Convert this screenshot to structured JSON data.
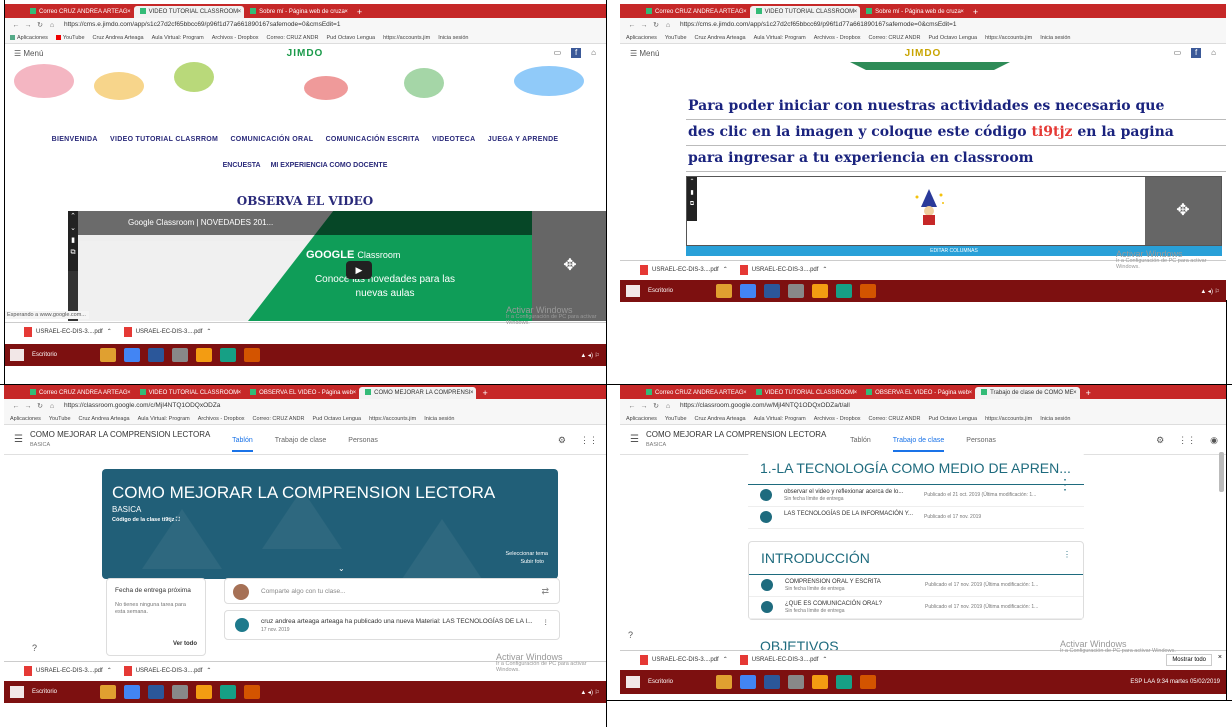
{
  "q1": {
    "tabs": [
      "Correo CRUZ ANDREA ARTEAG",
      "VIDEO TUTORIAL CLASSROOM",
      "Sobre mí - Página web de cruza"
    ],
    "url": "https://cms.e.jimdo.com/app/s1c27d2cf65bbcc69/p96f1d77a661890167safemode=0&cmsEdit=1",
    "bookmarks": [
      "Aplicaciones",
      "YouTube",
      "Cruz Andrea Arteaga",
      "Aula Virtual: Program",
      "Archivos - Dropbox",
      "Correo: CRUZ ANDR",
      "Pud Octavo Lengua",
      "https://accounts.jim",
      "Inicia sesión"
    ],
    "menu": "☰ Menú",
    "logo": "JIMDO",
    "nav1": [
      "BIENVENIDA",
      "VIDEO TUTORIAL CLASRROM",
      "COMUNICACIÓN ORAL",
      "COMUNICACIÓN ESCRITA",
      "VIDEOTECA",
      "JUEGA Y APRENDE"
    ],
    "nav2": [
      "ENCUESTA",
      "MI EXPERIENCIA COMO DOCENTE"
    ],
    "heading": "OBSERVA EL VIDEO",
    "video_title": "Google Classroom | NOVEDADES 201...",
    "video_brand": "GOOGLE",
    "video_brand2": "Classroom",
    "video_sub": "Conoce las novedades para las nuevas aulas",
    "status": "Esperando a www.google.com...",
    "downloads": [
      "USRAEL-EC-DIS-3....pdf",
      "USRAEL-EC-DIS-3....pdf"
    ],
    "download_sub": "Error: Error en el análisis antivi...",
    "wm1": "Activar Windows",
    "wm2": "Ir a Configuración de PC para activar Windows.",
    "taskbar_search": "Escritorio"
  },
  "q2": {
    "tabs": [
      "Correo CRUZ ANDREA ARTEAG",
      "VIDEO TUTORIAL CLASSROOM",
      "Sobre mí - Página web de cruza"
    ],
    "url": "https://cms.e.jimdo.com/app/s1c27d2cf65bbcc69/p96f1d77a661890167safemode=0&cmsEdit=1",
    "logo": "JIMDO",
    "line1": "Para poder iniciar con nuestras actividades   es necesario que",
    "line2a": "des clic en  la imagen y coloque este código  ",
    "code": "ti9tjz",
    "line2b": " en la pagina",
    "line3": "para ingresar a tu experiencia en classroom",
    "edit_columns": "EDITAR COLUMNAS",
    "downloads": [
      "USRAEL-EC-DIS-3....pdf",
      "USRAEL-EC-DIS-3....pdf"
    ],
    "wm1": "Activar Windows",
    "wm2": "Ir a Configuración de PC para activar Windows.",
    "taskbar_search": "Escritorio"
  },
  "q3": {
    "tabs": [
      "Correo CRUZ ANDREA ARTEAG",
      "VIDEO TUTORIAL CLASSROOM",
      "OBSERVA EL VIDEO - Página web",
      "COMO MEJORAR LA COMPRENSI"
    ],
    "url": "https://classroom.google.com/c/MjI4NTQ1ODQxODZa",
    "class_title": "COMO MEJORAR LA COMPRENSION LECTORA",
    "class_section": "BASICA",
    "tab_stream": "Tablón",
    "tab_work": "Trabajo de clase",
    "tab_people": "Personas",
    "hero_title": "COMO MEJORAR LA COMPRENSION LECTORA",
    "hero_section": "BASICA",
    "class_code_label": "Código de la clase",
    "class_code": "ti9tjz",
    "select_theme": "Seleccionar tema",
    "upload_photo": "Subir foto",
    "due_title": "Fecha de entrega próxima",
    "due_text": "No tienes ninguna tarea para esta semana.",
    "see_all": "Ver todo",
    "share_placeholder": "Comparte algo con tu clase...",
    "post_text": "cruz andrea arteaga arteaga ha publicado una nueva Material: LAS TECNOLOGÍAS DE LA I...",
    "post_date": "17 nov. 2019",
    "downloads": [
      "USRAEL-EC-DIS-3....pdf",
      "USRAEL-EC-DIS-3....pdf"
    ],
    "wm1": "Activar Windows",
    "wm2": "Ir a Configuración de PC para activar Windows.",
    "taskbar_search": "Escritorio"
  },
  "q4": {
    "tabs": [
      "Correo CRUZ ANDREA ARTEAG",
      "VIDEO TUTORIAL CLASSROOM",
      "OBSERVA EL VIDEO - Página web",
      "Trabajo de clase de COMO ME"
    ],
    "url": "https://classroom.google.com/w/MjI4NTQ1ODQxODZa/t/all",
    "class_title": "COMO MEJORAR LA COMPRENSION LECTORA",
    "class_section": "BASICA",
    "tab_stream": "Tablón",
    "tab_work": "Trabajo de clase",
    "tab_people": "Personas",
    "topic1": "1.-LA TECNOLOGÍA COMO MEDIO DE APREN...",
    "t1_items": [
      {
        "title": "observar el video y reflexionar acerca de lo...",
        "sub": "Sin fecha límite de entrega",
        "pub": "Publicado el 21 oct. 2019 (Última modificación: 1..."
      },
      {
        "title": "LAS TECNOLOGÍAS DE LA INFORMACIÓN Y...",
        "sub": "",
        "pub": "Publicado el 17 nov. 2019"
      }
    ],
    "topic2": "INTRODUCCIÓN",
    "t2_items": [
      {
        "title": "COMPRENSION ORAL Y ESCRITA",
        "sub": "Sin fecha límite de entrega",
        "pub": "Publicado el 17 nov. 2019 (Última modificación: 1..."
      },
      {
        "title": "¿QUE ES COMUNICACIÓN ORAL?",
        "sub": "Sin fecha límite de entrega",
        "pub": "Publicado el 17 nov. 2019 (Última modificación: 1..."
      }
    ],
    "topic3": "OBJETIVOS",
    "downloads": [
      "USRAEL-EC-DIS-3....pdf",
      "USRAEL-EC-DIS-3....pdf"
    ],
    "show_all": "Mostrar todo",
    "wm1": "Activar Windows",
    "wm2": "Ir a Configuración de PC para activar Windows.",
    "taskbar_search": "Escritorio",
    "time": "9:34 martes",
    "date": "05/02/2019",
    "lang": "ESP LAA"
  }
}
